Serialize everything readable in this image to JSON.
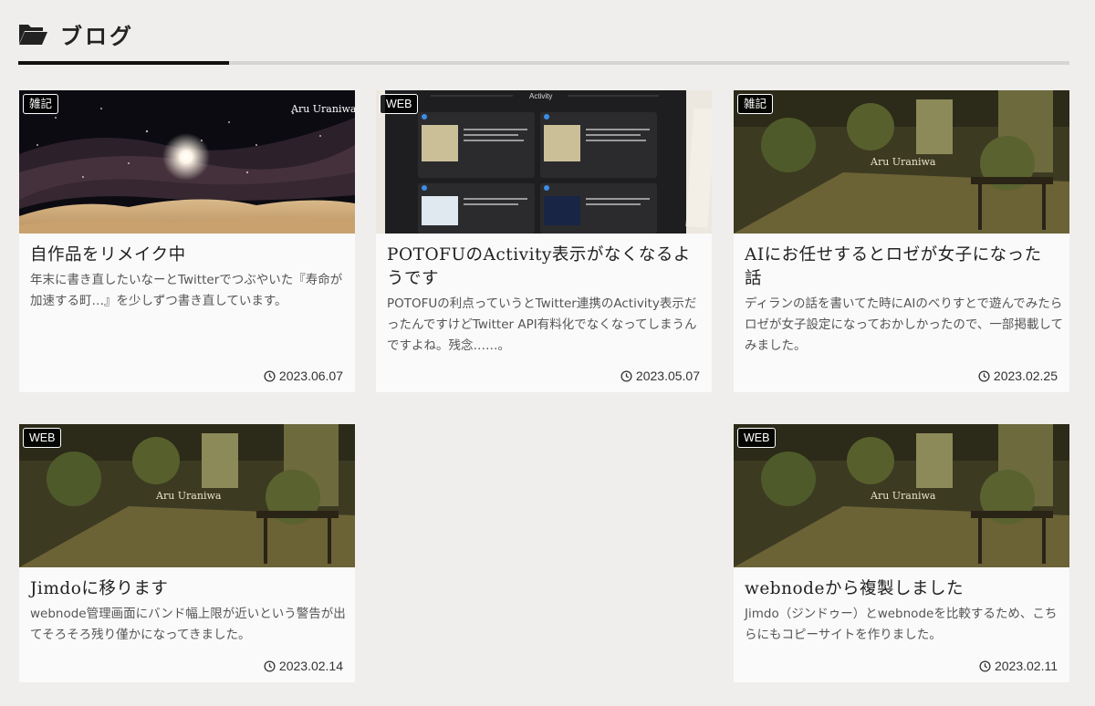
{
  "section": {
    "title": "ブログ",
    "icon": "folder-open-icon"
  },
  "posts": [
    {
      "badge": "雑記",
      "title": "自作品をリメイク中",
      "excerpt": "年末に書き直したいなーとTwitterでつぶやいた『寿命が加速する町…』を少しずつ書き直しています。",
      "date": "2023.06.07",
      "thumb_caption": "Aru Uraniwa"
    },
    {
      "badge": "WEB",
      "title": "POTOFUのActivity表示がなくなるようです",
      "excerpt": "POTOFUの利点っていうとTwitter連携のActivity表示だったんですけどTwitter API有料化でなくなってしまうんですよね。残念……。",
      "date": "2023.05.07",
      "thumb_caption": "Activity"
    },
    {
      "badge": "雑記",
      "title": "AIにお任せするとロゼが女子になった話",
      "excerpt": "ディランの話を書いてた時にAIのべりすとで遊んでみたらロゼが女子設定になっておかしかったので、一部掲載してみました。",
      "date": "2023.02.25",
      "thumb_caption": "Aru Uraniwa"
    },
    {
      "badge": "WEB",
      "title": "Jimdoに移ります",
      "excerpt": "webnode管理画面にバンド幅上限が近いという警告が出てそろそろ残り僅かになってきました。",
      "date": "2023.02.14",
      "thumb_caption": "Aru Uraniwa"
    },
    {
      "badge": "WEB",
      "title": "webnodeから複製しました",
      "excerpt": "Jimdo（ジンドゥー）とwebnodeを比較するため、こちらにもコピーサイトを作りました。",
      "date": "2023.02.11",
      "thumb_caption": "Aru Uraniwa"
    }
  ],
  "colors": {
    "page_bg": "#efeeec",
    "card_bg": "#fafafa",
    "accent_rule": "#111111",
    "rule": "#d6d5d3"
  }
}
